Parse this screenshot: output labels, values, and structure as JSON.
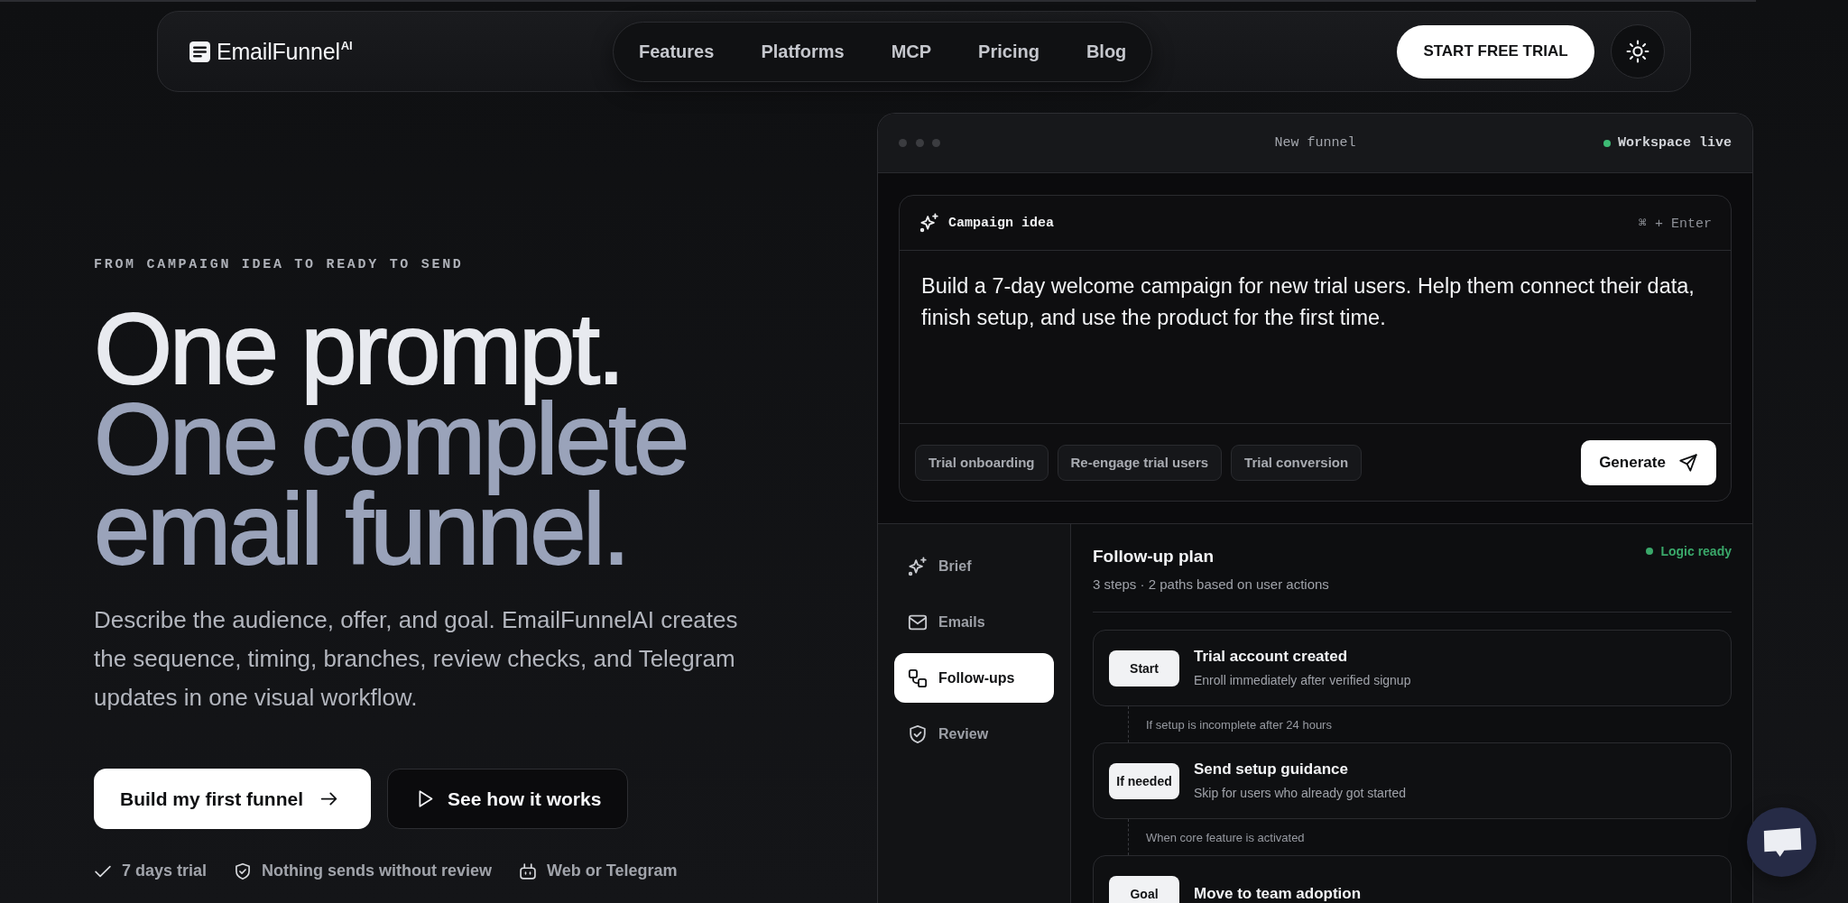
{
  "nav": {
    "logo": "EmailFunnel$^{AI}$",
    "links": [
      {
        "label": "Features"
      },
      {
        "label": "Platforms"
      },
      {
        "label": "MCP"
      },
      {
        "label": "Pricing"
      },
      {
        "label": "Blog"
      }
    ],
    "cta": "START FREE TRIAL"
  },
  "hero": {
    "eyebrow": "FROM CAMPAIGN IDEA TO READY TO SEND",
    "headline": [
      "One prompt.",
      "One complete email funnel."
    ],
    "description": "Describe the audience, offer, and goal. EmailFunnelAI creates the sequence, timing, branches, review checks, and Telegram updates in one visual workflow.",
    "buttons": [
      {
        "label": "Build my first funnel",
        "kind": "primary"
      },
      {
        "label": "See how it works",
        "kind": "secondary"
      }
    ],
    "highlights": [
      "7 days trial",
      "Nothing sends without review",
      "Web or Telegram"
    ]
  },
  "workspace": {
    "window": {
      "title": "New funnel",
      "status": "Workspace live"
    },
    "prompt": {
      "title": "Campaign idea",
      "shortcut": "⌘ + Enter",
      "value": "Build a 7-day welcome campaign for new trial users. Help them connect their data, finish setup, and use the product for the first time.",
      "suggestions": [
        "Trial onboarding",
        "Re-engage trial users",
        "Trial conversion"
      ],
      "submit": "Generate"
    },
    "sidebar": {
      "items": [
        {
          "label": "Brief",
          "selected": false
        },
        {
          "label": "Emails",
          "selected": false
        },
        {
          "label": "Follow-ups",
          "selected": true
        },
        {
          "label": "Review",
          "selected": false
        }
      ]
    },
    "plan": {
      "title": "Follow-up plan",
      "subtitle": "3 steps · 2 paths based on user actions",
      "status": "Logic ready",
      "flow": [
        {
          "kind": "step",
          "badge": "Start",
          "title": "Trial account created",
          "description": "Enroll immediately after verified signup"
        },
        {
          "kind": "condition",
          "text": "If setup is incomplete after 24 hours"
        },
        {
          "kind": "step",
          "badge": "If needed",
          "title": "Send setup guidance",
          "description": "Skip for users who already got started"
        },
        {
          "kind": "condition",
          "text": "When core feature is activated"
        },
        {
          "kind": "step",
          "badge": "Goal",
          "title": "Move to team adoption"
        }
      ]
    }
  }
}
